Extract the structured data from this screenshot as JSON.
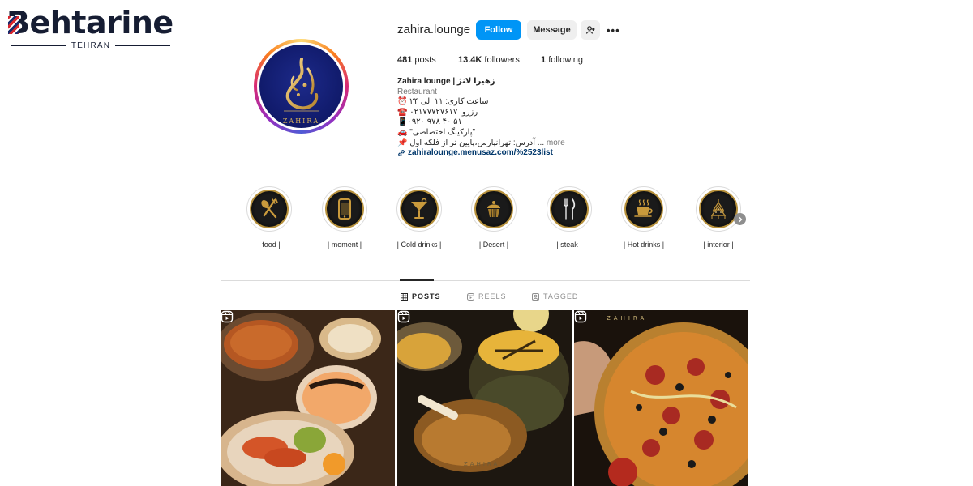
{
  "watermark": {
    "brand": "Behtarine",
    "brand_rest": "ehtarine",
    "city": "TEHRAN"
  },
  "profile": {
    "username": "zahira.lounge",
    "follow_label": "Follow",
    "message_label": "Message",
    "more_label": "•••",
    "logo_text": "ZAHIRA",
    "posts_count": "481",
    "posts_label": "posts",
    "followers_count": "13.4K",
    "followers_label": "followers",
    "following_count": "1",
    "following_label": "following"
  },
  "bio": {
    "name": "Zahira lounge | زهیرا لانژ",
    "category": "Restaurant",
    "line1": "⏰ ساعت کاری: ۱۱ الی ۲۴",
    "line2": "☎️ رزرو: ۰۲۱۷۷۷۲۷۶۱۷",
    "line3": "📱۰۹۲۰ ۹۷۸ ۴۰ ۵۱",
    "line4": "🚗 \"پارکینگ اختصاصی\"",
    "line5": "📌 آدرس: تهرانپارس،پایین تر از فلکه اول ...",
    "more": "more",
    "link": "zahiralounge.menusaz.com/%2523list"
  },
  "highlights": [
    {
      "label": "| food |",
      "icon": "fork-spoon-icon"
    },
    {
      "label": "| moment |",
      "icon": "phone-icon"
    },
    {
      "label": "| Cold drinks |",
      "icon": "cocktail-icon"
    },
    {
      "label": "| Desert |",
      "icon": "cupcake-icon"
    },
    {
      "label": "| steak |",
      "icon": "knife-fork-icon"
    },
    {
      "label": "| Hot drinks |",
      "icon": "hot-cup-icon"
    },
    {
      "label": "| interior |",
      "icon": "chandelier-icon"
    }
  ],
  "tabs": [
    {
      "label": "POSTS",
      "active": true
    },
    {
      "label": "REELS",
      "active": false
    },
    {
      "label": "TAGGED",
      "active": false
    }
  ],
  "posts": [
    {
      "desc": "rice dish with kebab and dips",
      "type": "reel"
    },
    {
      "desc": "saffron rice with lamb shank",
      "type": "reel",
      "watermark": "ZAHIRA"
    },
    {
      "desc": "pizza with pepperoni and olives",
      "type": "reel",
      "watermark": "ZAHIRA"
    }
  ],
  "colors": {
    "follow": "#0095f6",
    "gold": "#b8923d",
    "navy": "#101a6a"
  }
}
